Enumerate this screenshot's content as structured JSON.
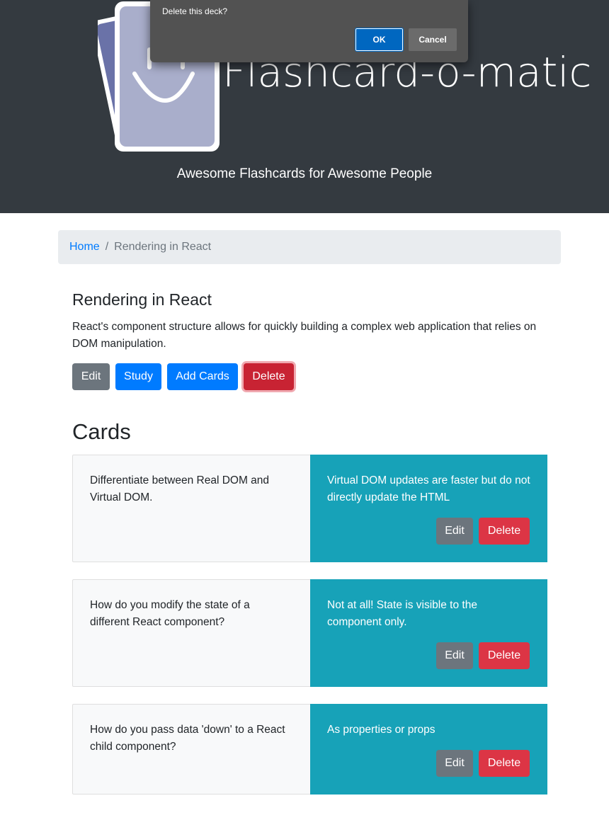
{
  "header": {
    "app_title": "Flashcard-o-matic",
    "tagline": "Awesome Flashcards for Awesome People"
  },
  "dialog": {
    "message": "Delete this deck?",
    "ok_label": "OK",
    "cancel_label": "Cancel"
  },
  "breadcrumb": {
    "home_label": "Home",
    "separator": "/",
    "current_label": "Rendering in React"
  },
  "deck": {
    "name": "Rendering in React",
    "description": "React's component structure allows for quickly building a complex web application that relies on DOM manipulation.",
    "edit_label": "Edit",
    "study_label": "Study",
    "add_cards_label": "Add Cards",
    "delete_label": "Delete"
  },
  "cards_heading": "Cards",
  "cards": [
    {
      "front": "Differentiate between Real DOM and Virtual DOM.",
      "back": "Virtual DOM updates are faster but do not directly update the HTML",
      "edit_label": "Edit",
      "delete_label": "Delete"
    },
    {
      "front": "How do you modify the state of a different React component?",
      "back": "Not at all! State is visible to the component only.",
      "edit_label": "Edit",
      "delete_label": "Delete"
    },
    {
      "front": "How do you pass data 'down' to a React child component?",
      "back": "As properties or props",
      "edit_label": "Edit",
      "delete_label": "Delete"
    }
  ],
  "colors": {
    "header_bg": "#343a40",
    "primary": "#007bff",
    "secondary": "#6c757d",
    "danger": "#dc3545",
    "info": "#17a2b8",
    "breadcrumb_bg": "#e9ecef",
    "dialog_bg": "#525252",
    "dialog_ok": "#0067c0"
  },
  "icons": {
    "logo": "smiling-flashcards-logo"
  }
}
